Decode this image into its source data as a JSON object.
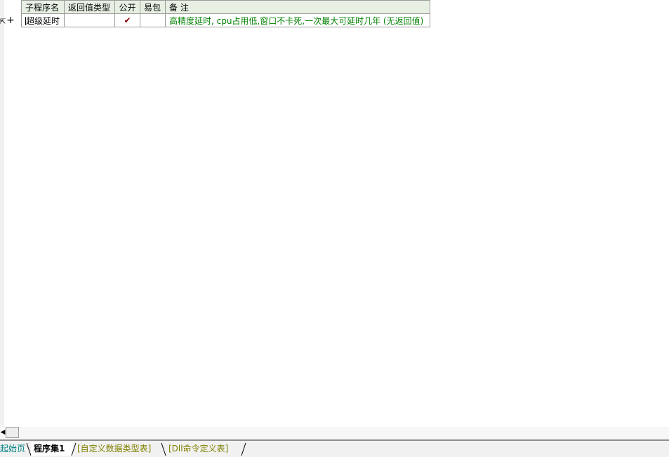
{
  "table": {
    "headers": [
      "子程序名",
      "返回值类型",
      "公开",
      "易包",
      "备 注"
    ],
    "row": {
      "name": "超级延时",
      "return_type": "",
      "public_mark": "✔",
      "epackage": "",
      "remark": "高精度延时, cpu占用低,窗口不卡死,一次最大可延时几年 (无返回值)"
    }
  },
  "gutter": {
    "expand_symbol": "+",
    "row_marker": "⇱"
  },
  "scroll": {
    "left_arrow": "◀"
  },
  "tabs": {
    "start": "起始页",
    "current": "程序集1",
    "custom_types": "[自定义数据类型表]",
    "dll_commands": "[Dll命令定义表]"
  },
  "colors": {
    "header_bg": "#e8f0e4",
    "remark_text": "#008000",
    "check_mark": "#8b0000",
    "tab_start": "#008080",
    "tab_inactive": "#808000"
  }
}
